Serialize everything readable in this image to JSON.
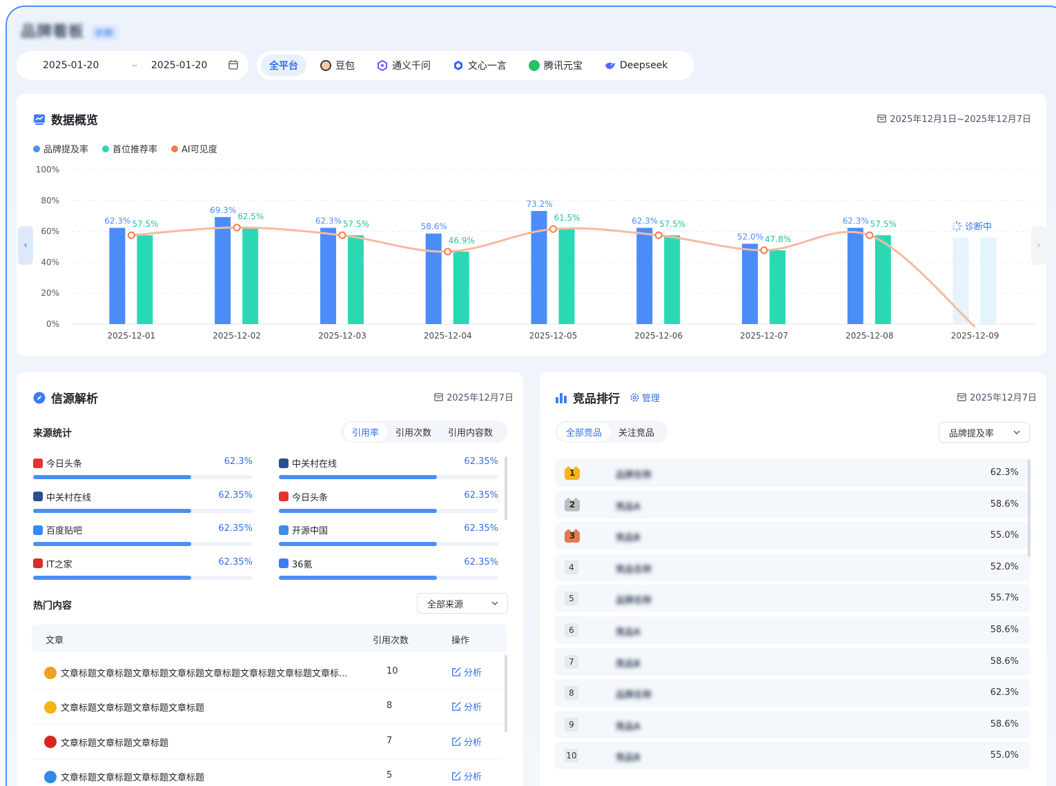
{
  "header": {
    "title": "品牌看板",
    "tag": "示例"
  },
  "date_range": {
    "start": "2025-01-20",
    "separator": "~",
    "end": "2025-01-20"
  },
  "platforms": [
    {
      "label": "全平台",
      "active": true,
      "icon": "all-platforms"
    },
    {
      "label": "豆包",
      "active": false,
      "icon": "doubao-avatar-icon"
    },
    {
      "label": "通义千问",
      "active": false,
      "icon": "tongyi-icon"
    },
    {
      "label": "文心一言",
      "active": false,
      "icon": "wenxin-icon"
    },
    {
      "label": "腾讯元宝",
      "active": false,
      "icon": "yuanbao-icon"
    },
    {
      "label": "Deepseek",
      "active": false,
      "icon": "deepseek-icon"
    }
  ],
  "overview": {
    "title": "数据概览",
    "date": "2025年12月1日~2025年12月7日",
    "diagnosing": "诊断中"
  },
  "chart_data": {
    "type": "bar",
    "categories": [
      "2025-12-01",
      "2025-12-02",
      "2025-12-03",
      "2025-12-04",
      "2025-12-05",
      "2025-12-06",
      "2025-12-07",
      "2025-12-08",
      "2025-12-09"
    ],
    "series": [
      {
        "name": "品牌提及率",
        "type": "bar",
        "values": [
          62.3,
          69.3,
          62.3,
          58.6,
          73.2,
          62.3,
          52.0,
          62.3,
          null
        ],
        "color": "#4b8df8"
      },
      {
        "name": "首位推荐率",
        "type": "bar",
        "values": [
          57.5,
          62.5,
          57.5,
          46.9,
          61.5,
          57.5,
          47.8,
          57.5,
          null
        ],
        "color": "#2ad9b4"
      },
      {
        "name": "AI可见度",
        "type": "line",
        "values": [
          57.5,
          62.5,
          57.5,
          46.9,
          61.5,
          57.5,
          47.8,
          57.5,
          0
        ],
        "color": "#f47b4f"
      }
    ],
    "ylim": [
      0,
      100
    ],
    "yticks": [
      "0%",
      "20%",
      "40%",
      "60%",
      "80%",
      "100%"
    ],
    "grid": true,
    "legend": "top-left"
  },
  "source": {
    "title": "信源解析",
    "date": "2025年12月7日",
    "stats_title": "来源统计",
    "tabs": [
      "引用率",
      "引用次数",
      "引用内容数"
    ],
    "items": [
      {
        "name": "今日头条",
        "value": "62.3%",
        "logo": "toutiao-icon",
        "color": "#e7322e",
        "level": 0.72
      },
      {
        "name": "中关村在线",
        "value": "62.35%",
        "logo": "zol-icon",
        "color": "#2b4f8c",
        "level": 0.72
      },
      {
        "name": "中关村在线",
        "value": "62.35%",
        "logo": "zol-icon",
        "color": "#2b4f8c",
        "level": 0.72
      },
      {
        "name": "今日头条",
        "value": "62.35%",
        "logo": "toutiao-icon",
        "color": "#e7322e",
        "level": 0.72
      },
      {
        "name": "百度贴吧",
        "value": "62.35%",
        "logo": "tieba-icon",
        "color": "#3388ff",
        "level": 0.72
      },
      {
        "name": "开源中国",
        "value": "62.35%",
        "logo": "oschina-icon",
        "color": "#3a8ee6",
        "level": 0.72
      },
      {
        "name": "IT之家",
        "value": "62.35%",
        "logo": "ithome-icon",
        "color": "#d92b2b",
        "level": 0.72
      },
      {
        "name": "36氪",
        "value": "62.35%",
        "logo": "36kr-icon",
        "color": "#3d7cf2",
        "level": 0.72
      }
    ],
    "hot_title": "热门内容",
    "hot_filter": "全部来源",
    "table_headers": [
      "文章",
      "引用次数",
      "操作"
    ],
    "rows": [
      {
        "title": "文章标题文章标题文章标题文章标题文章标题文章标题文章标题文章标...",
        "count": "10",
        "op": "分析",
        "logo": "sina-icon",
        "color": "#f0a020"
      },
      {
        "title": "文章标题文章标题文章标题文章标题",
        "count": "8",
        "op": "分析",
        "logo": "sohu-fox-icon",
        "color": "#f6b21a"
      },
      {
        "title": "文章标题文章标题文章标题",
        "count": "7",
        "op": "分析",
        "logo": "netease-icon",
        "color": "#d8281e"
      },
      {
        "title": "文章标题文章标题文章标题文章标题",
        "count": "5",
        "op": "分析",
        "logo": "tencent-news-icon",
        "color": "#2f8ae8"
      }
    ]
  },
  "ranking": {
    "title": "竞品排行",
    "manage": "管理",
    "date": "2025年12月7日",
    "tabs": [
      "全部竞品",
      "关注竞品"
    ],
    "metric": "品牌提及率",
    "rows": [
      {
        "rank": "1",
        "name": "品牌名称",
        "value": "62.3%"
      },
      {
        "rank": "2",
        "name": "竞品A",
        "value": "58.6%"
      },
      {
        "rank": "3",
        "name": "竞品B",
        "value": "55.0%"
      },
      {
        "rank": "4",
        "name": "竞品名称",
        "value": "52.0%"
      },
      {
        "rank": "5",
        "name": "品牌名称",
        "value": "55.7%"
      },
      {
        "rank": "6",
        "name": "竞品A",
        "value": "58.6%"
      },
      {
        "rank": "7",
        "name": "竞品B",
        "value": "58.6%"
      },
      {
        "rank": "8",
        "name": "品牌名称",
        "value": "62.3%"
      },
      {
        "rank": "9",
        "name": "竞品A",
        "value": "58.6%"
      },
      {
        "rank": "10",
        "name": "竞品B",
        "value": "55.0%"
      }
    ]
  }
}
